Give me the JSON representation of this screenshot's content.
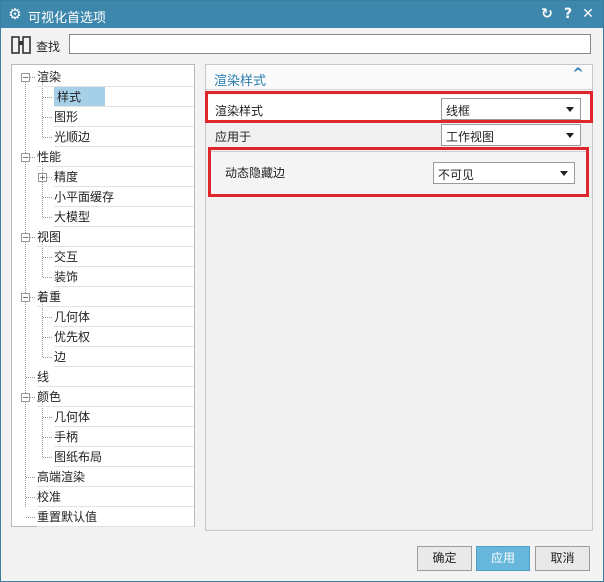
{
  "window": {
    "title": "可视化首选项"
  },
  "search": {
    "label": "查找",
    "value": ""
  },
  "tree": [
    {
      "label": "渲染",
      "selected": false
    },
    {
      "label": "样式",
      "selected": true
    },
    {
      "label": "图形",
      "selected": false
    },
    {
      "label": "光顺边",
      "selected": false
    },
    {
      "label": "性能",
      "selected": false
    },
    {
      "label": "精度",
      "selected": false
    },
    {
      "label": "小平面缓存",
      "selected": false
    },
    {
      "label": "大模型",
      "selected": false
    },
    {
      "label": "视图",
      "selected": false
    },
    {
      "label": "交互",
      "selected": false
    },
    {
      "label": "装饰",
      "selected": false
    },
    {
      "label": "着重",
      "selected": false
    },
    {
      "label": "几何体",
      "selected": false
    },
    {
      "label": "优先权",
      "selected": false
    },
    {
      "label": "边",
      "selected": false
    },
    {
      "label": "线",
      "selected": false
    },
    {
      "label": "颜色",
      "selected": false
    },
    {
      "label": "几何体",
      "selected": false
    },
    {
      "label": "手柄",
      "selected": false
    },
    {
      "label": "图纸布局",
      "selected": false
    },
    {
      "label": "高端渲染",
      "selected": false
    },
    {
      "label": "校准",
      "selected": false
    },
    {
      "label": "重置默认值",
      "selected": false
    }
  ],
  "section": {
    "title": "渲染样式"
  },
  "fields": {
    "render_style": {
      "label": "渲染样式",
      "value": "线框"
    },
    "apply_to": {
      "label": "应用于",
      "value": "工作视图"
    },
    "dynamic_hidden_edges": {
      "label": "动态隐藏边",
      "value": "不可见"
    }
  },
  "buttons": {
    "ok": "确定",
    "apply": "应用",
    "cancel": "取消"
  },
  "colors": {
    "titlebar": "#3d87ad",
    "accent": "#2b7fb0",
    "selection": "#a6cfe8",
    "highlight_box": "#e0262b",
    "apply_button": "#67b7dc"
  }
}
